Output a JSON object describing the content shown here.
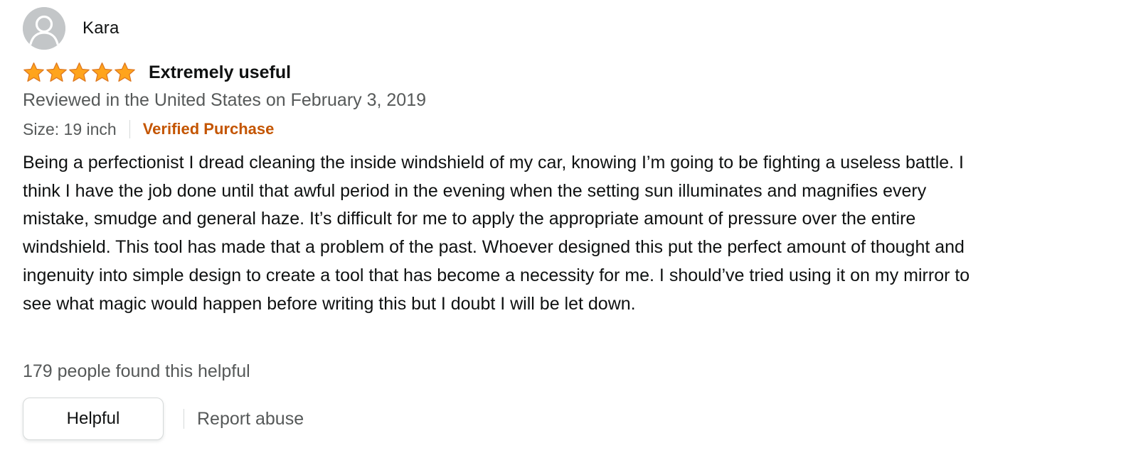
{
  "reviewer": {
    "name": "Kara",
    "avatar_icon": "user-silhouette-icon"
  },
  "rating": {
    "stars": 5,
    "max": 5,
    "star_color": "#ffa41c",
    "star_outline": "#de7921"
  },
  "review": {
    "title": "Extremely useful",
    "date_line": "Reviewed in the United States on February 3, 2019",
    "size": "Size: 19 inch",
    "verified": "Verified Purchase",
    "body": "Being a perfectionist I dread cleaning the inside windshield of my car, knowing I’m going to be fighting a useless battle. I think I have the job done until that awful period in the evening when the setting sun illuminates and magnifies every mistake, smudge and general haze. It’s difficult for me to apply the appropriate amount of pressure over the entire windshield. This tool has made that a problem of the past. Whoever designed this put the perfect amount of thought and ingenuity into simple design to create a tool that has become a necessity for me. I should’ve tried using it on my mirror to see what magic would happen before writing this but I doubt I will be let down."
  },
  "feedback": {
    "helpful_count": "179 people found this helpful",
    "helpful_button": "Helpful",
    "report": "Report abuse"
  },
  "colors": {
    "text": "#0f1111",
    "muted": "#565959",
    "verified": "#c45500",
    "avatar_bg": "#c3c6c8"
  }
}
